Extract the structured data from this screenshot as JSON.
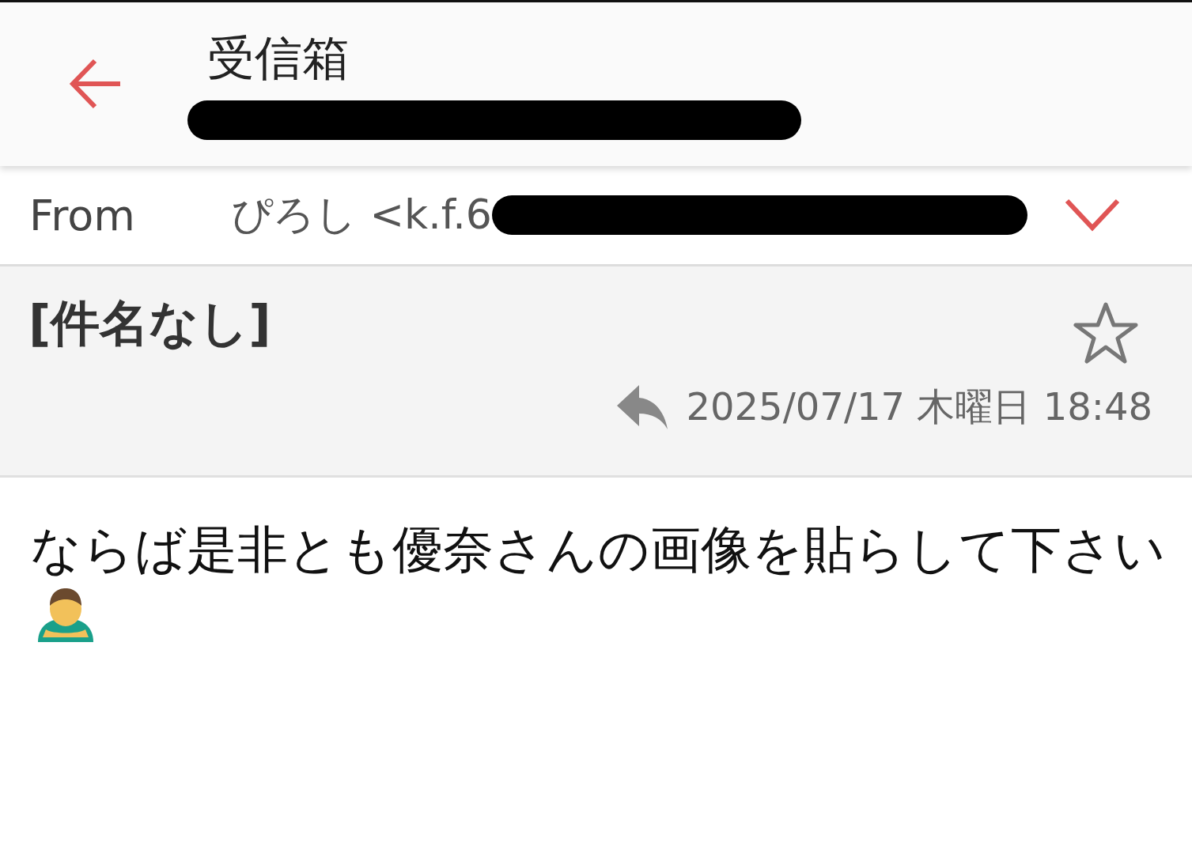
{
  "header": {
    "title": "受信箱"
  },
  "from": {
    "label": "From",
    "sender": "ぴろし <k.f.6",
    "expanded": false
  },
  "message": {
    "subject": "[件名なし]",
    "starred": false,
    "replied": true,
    "date": "2025/07/17 木曜日 18:48"
  },
  "body": {
    "text": "ならば是非とも優奈さんの画像を貼らして下さい"
  }
}
